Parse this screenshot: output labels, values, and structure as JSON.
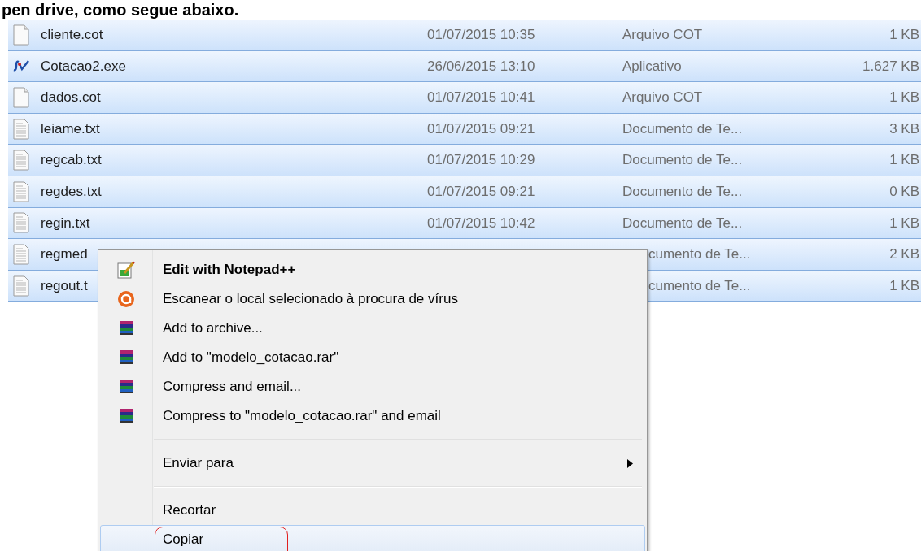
{
  "caption": "pen drive, como segue abaixo.",
  "files": [
    {
      "kind": "blank",
      "name": "cliente.cot",
      "date": "01/07/2015 10:35",
      "type": "Arquivo COT",
      "size": "1 KB",
      "selected": true,
      "covered": false
    },
    {
      "kind": "exe",
      "name": "Cotacao2.exe",
      "date": "26/06/2015 13:10",
      "type": "Aplicativo",
      "size": "1.627 KB",
      "selected": true,
      "covered": false
    },
    {
      "kind": "blank",
      "name": "dados.cot",
      "date": "01/07/2015 10:41",
      "type": "Arquivo COT",
      "size": "1 KB",
      "selected": true,
      "covered": false
    },
    {
      "kind": "text",
      "name": "leiame.txt",
      "date": "01/07/2015 09:21",
      "type": "Documento de Te...",
      "size": "3 KB",
      "selected": true,
      "covered": false
    },
    {
      "kind": "text",
      "name": "regcab.txt",
      "date": "01/07/2015 10:29",
      "type": "Documento de Te...",
      "size": "1 KB",
      "selected": true,
      "covered": false
    },
    {
      "kind": "text",
      "name": "regdes.txt",
      "date": "01/07/2015 09:21",
      "type": "Documento de Te...",
      "size": "0 KB",
      "selected": true,
      "covered": false
    },
    {
      "kind": "text",
      "name": "regin.txt",
      "date": "01/07/2015 10:42",
      "type": "Documento de Te...",
      "size": "1 KB",
      "selected": true,
      "covered": false
    },
    {
      "kind": "text",
      "name": "regmed",
      "type": "cumento de Te...",
      "size": "2 KB",
      "selected": true,
      "covered": true
    },
    {
      "kind": "text",
      "name": "regout.t",
      "type": "cumento de Te...",
      "size": "1 KB",
      "selected": true,
      "covered": true
    }
  ],
  "context_menu": {
    "items": [
      {
        "kind": "notepad",
        "label": "Edit with Notepad++",
        "bold": true,
        "selected": false
      },
      {
        "kind": "scan",
        "label": "Escanear o local selecionado à procura de vírus",
        "bold": false,
        "selected": false
      },
      {
        "kind": "archive",
        "label": "Add to archive...",
        "bold": false,
        "selected": false
      },
      {
        "kind": "archive",
        "label": "Add to \"modelo_cotacao.rar\"",
        "bold": false,
        "selected": false
      },
      {
        "kind": "archive",
        "label": "Compress and email...",
        "bold": false,
        "selected": false
      },
      {
        "kind": "archive",
        "label": "Compress to \"modelo_cotacao.rar\" and email",
        "bold": false,
        "selected": false
      },
      {
        "kind": "separator"
      },
      {
        "kind": "submenu",
        "label": "Enviar para",
        "bold": false,
        "selected": false
      },
      {
        "kind": "separator"
      },
      {
        "kind": "plain",
        "label": "Recortar",
        "bold": false,
        "selected": false
      },
      {
        "kind": "plain",
        "label": "Copiar",
        "bold": false,
        "selected": true,
        "circled": true
      }
    ]
  }
}
